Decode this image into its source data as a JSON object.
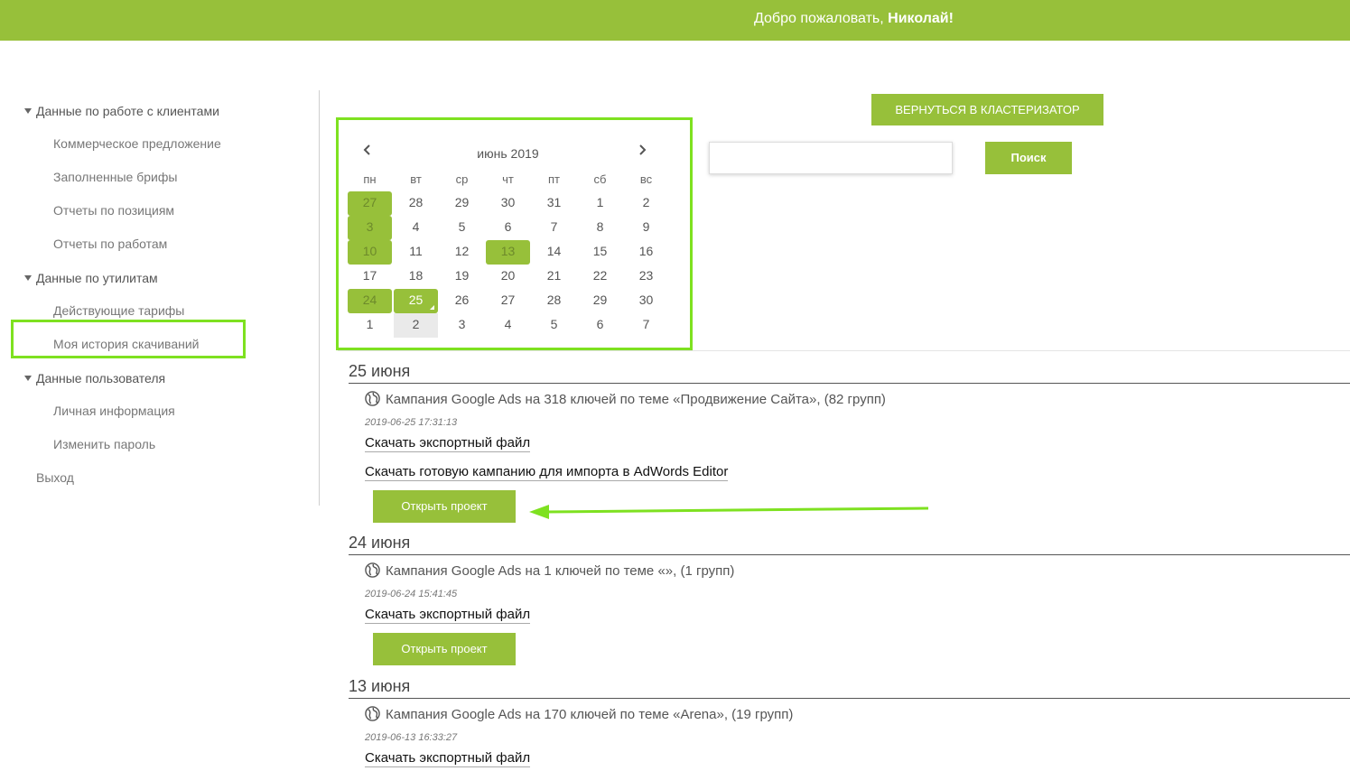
{
  "header": {
    "welcome_prefix": "Добро пожаловать, ",
    "user_name": "Николай!",
    "accent_color": "#97c03a"
  },
  "sidebar": {
    "groups": [
      {
        "label": "Данные по работе с клиентами",
        "items": [
          "Коммерческое предложение",
          "Заполненные брифы",
          "Отчеты по позициям",
          "Отчеты по работам"
        ]
      },
      {
        "label": "Данные по утилитам",
        "items": [
          "Действующие тарифы",
          "Моя история скачиваний"
        ]
      },
      {
        "label": "Данные пользователя",
        "items": [
          "Личная информация",
          "Изменить пароль"
        ]
      }
    ],
    "exit_label": "Выход",
    "active_item": "Моя история скачиваний"
  },
  "calendar": {
    "title": "июнь 2019",
    "prev_icon": "chevron-left-icon",
    "next_icon": "chevron-right-icon",
    "weekdays": [
      "пн",
      "вт",
      "ср",
      "чт",
      "пт",
      "сб",
      "вс"
    ],
    "weeks": [
      [
        "27",
        "28",
        "29",
        "30",
        "31",
        "1",
        "2"
      ],
      [
        "3",
        "4",
        "5",
        "6",
        "7",
        "8",
        "9"
      ],
      [
        "10",
        "11",
        "12",
        "13",
        "14",
        "15",
        "16"
      ],
      [
        "17",
        "18",
        "19",
        "20",
        "21",
        "22",
        "23"
      ],
      [
        "24",
        "25",
        "26",
        "27",
        "28",
        "29",
        "30"
      ],
      [
        "1",
        "2",
        "3",
        "4",
        "5",
        "6",
        "7"
      ]
    ],
    "marked_days": [
      [
        0,
        0
      ],
      [
        1,
        0
      ],
      [
        2,
        0
      ],
      [
        2,
        3
      ],
      [
        4,
        0
      ]
    ],
    "selected_day": [
      4,
      1
    ],
    "today_day": [
      5,
      1
    ]
  },
  "toolbar": {
    "back_label": "ВЕРНУТЬСЯ В КЛАСТЕРИЗАТОР",
    "search_value": "",
    "search_label": "Поиск"
  },
  "history": [
    {
      "date": "25 июня",
      "entries": [
        {
          "title": "Кампания Google Ads на 318 ключей по теме «Продвижение Сайта», (82 групп)",
          "timestamp": "2019-06-25 17:31:13",
          "download_export": "Скачать экспортный файл",
          "download_adwords": "Скачать готовую кампанию для импорта в AdWords Editor",
          "open_label": "Открыть проект"
        }
      ]
    },
    {
      "date": "24 июня",
      "entries": [
        {
          "title": "Кампания Google Ads на 1 ключей по теме «», (1 групп)",
          "timestamp": "2019-06-24 15:41:45",
          "download_export": "Скачать экспортный файл",
          "open_label": "Открыть проект"
        }
      ]
    },
    {
      "date": "13 июня",
      "entries": [
        {
          "title": "Кампания Google Ads на 170 ключей по теме «Arena», (19 групп)",
          "timestamp": "2019-06-13 16:33:27",
          "download_export": "Скачать экспортный файл"
        }
      ]
    }
  ],
  "annotations": {
    "highlight_color": "#7ee120"
  }
}
